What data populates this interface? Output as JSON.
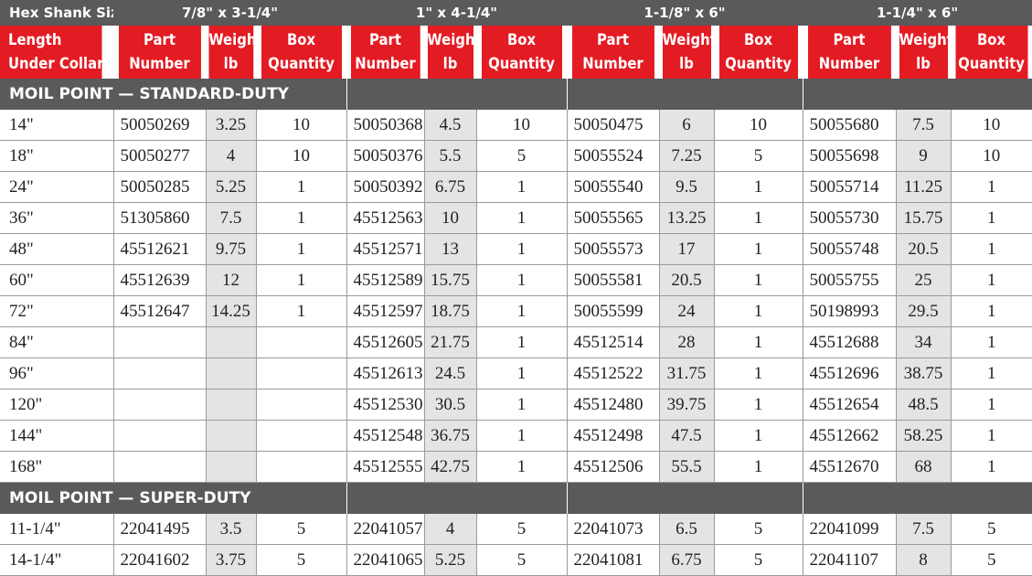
{
  "header": {
    "hex_shank_label": "Hex Shank Size",
    "sizes": [
      "7/8\" x 3-1/4\"",
      "1\" x 4-1/4\"",
      "1-1/8\" x 6\"",
      "1-1/4\" x 6\""
    ]
  },
  "columns": {
    "length_line1": "Length",
    "length_line2": "Under Collar",
    "part_line1": "Part",
    "part_line2": "Number",
    "weight_line1": "Weight",
    "weight_line2": "lb",
    "box_line1": "Box",
    "box_line2": "Quantity"
  },
  "sections": [
    {
      "title": "MOIL POINT — STANDARD-DUTY",
      "rows": [
        {
          "length": "14\"",
          "groups": [
            [
              "50050269",
              "3.25",
              "10"
            ],
            [
              "50050368",
              "4.5",
              "10"
            ],
            [
              "50050475",
              "6",
              "10"
            ],
            [
              "50055680",
              "7.5",
              "10"
            ]
          ]
        },
        {
          "length": "18\"",
          "groups": [
            [
              "50050277",
              "4",
              "10"
            ],
            [
              "50050376",
              "5.5",
              "5"
            ],
            [
              "50055524",
              "7.25",
              "5"
            ],
            [
              "50055698",
              "9",
              "10"
            ]
          ]
        },
        {
          "length": "24\"",
          "groups": [
            [
              "50050285",
              "5.25",
              "1"
            ],
            [
              "50050392",
              "6.75",
              "1"
            ],
            [
              "50055540",
              "9.5",
              "1"
            ],
            [
              "50055714",
              "11.25",
              "1"
            ]
          ]
        },
        {
          "length": "36\"",
          "groups": [
            [
              "51305860",
              "7.5",
              "1"
            ],
            [
              "45512563",
              "10",
              "1"
            ],
            [
              "50055565",
              "13.25",
              "1"
            ],
            [
              "50055730",
              "15.75",
              "1"
            ]
          ]
        },
        {
          "length": "48\"",
          "groups": [
            [
              "45512621",
              "9.75",
              "1"
            ],
            [
              "45512571",
              "13",
              "1"
            ],
            [
              "50055573",
              "17",
              "1"
            ],
            [
              "50055748",
              "20.5",
              "1"
            ]
          ]
        },
        {
          "length": "60\"",
          "groups": [
            [
              "45512639",
              "12",
              "1"
            ],
            [
              "45512589",
              "15.75",
              "1"
            ],
            [
              "50055581",
              "20.5",
              "1"
            ],
            [
              "50055755",
              "25",
              "1"
            ]
          ]
        },
        {
          "length": "72\"",
          "groups": [
            [
              "45512647",
              "14.25",
              "1"
            ],
            [
              "45512597",
              "18.75",
              "1"
            ],
            [
              "50055599",
              "24",
              "1"
            ],
            [
              "50198993",
              "29.5",
              "1"
            ]
          ]
        },
        {
          "length": "84\"",
          "groups": [
            [
              "",
              "",
              ""
            ],
            [
              "45512605",
              "21.75",
              "1"
            ],
            [
              "45512514",
              "28",
              "1"
            ],
            [
              "45512688",
              "34",
              "1"
            ]
          ]
        },
        {
          "length": "96\"",
          "groups": [
            [
              "",
              "",
              ""
            ],
            [
              "45512613",
              "24.5",
              "1"
            ],
            [
              "45512522",
              "31.75",
              "1"
            ],
            [
              "45512696",
              "38.75",
              "1"
            ]
          ]
        },
        {
          "length": "120\"",
          "groups": [
            [
              "",
              "",
              ""
            ],
            [
              "45512530",
              "30.5",
              "1"
            ],
            [
              "45512480",
              "39.75",
              "1"
            ],
            [
              "45512654",
              "48.5",
              "1"
            ]
          ]
        },
        {
          "length": "144\"",
          "groups": [
            [
              "",
              "",
              ""
            ],
            [
              "45512548",
              "36.75",
              "1"
            ],
            [
              "45512498",
              "47.5",
              "1"
            ],
            [
              "45512662",
              "58.25",
              "1"
            ]
          ]
        },
        {
          "length": "168\"",
          "groups": [
            [
              "",
              "",
              ""
            ],
            [
              "45512555",
              "42.75",
              "1"
            ],
            [
              "45512506",
              "55.5",
              "1"
            ],
            [
              "45512670",
              "68",
              "1"
            ]
          ]
        }
      ]
    },
    {
      "title": "MOIL POINT — SUPER-DUTY",
      "rows": [
        {
          "length": "11-1/4\"",
          "groups": [
            [
              "22041495",
              "3.5",
              "5"
            ],
            [
              "22041057",
              "4",
              "5"
            ],
            [
              "22041073",
              "6.5",
              "5"
            ],
            [
              "22041099",
              "7.5",
              "5"
            ]
          ]
        },
        {
          "length": "14-1/4\"",
          "groups": [
            [
              "22041602",
              "3.75",
              "5"
            ],
            [
              "22041065",
              "5.25",
              "5"
            ],
            [
              "22041081",
              "6.75",
              "5"
            ],
            [
              "22041107",
              "8",
              "5"
            ]
          ]
        }
      ]
    }
  ]
}
